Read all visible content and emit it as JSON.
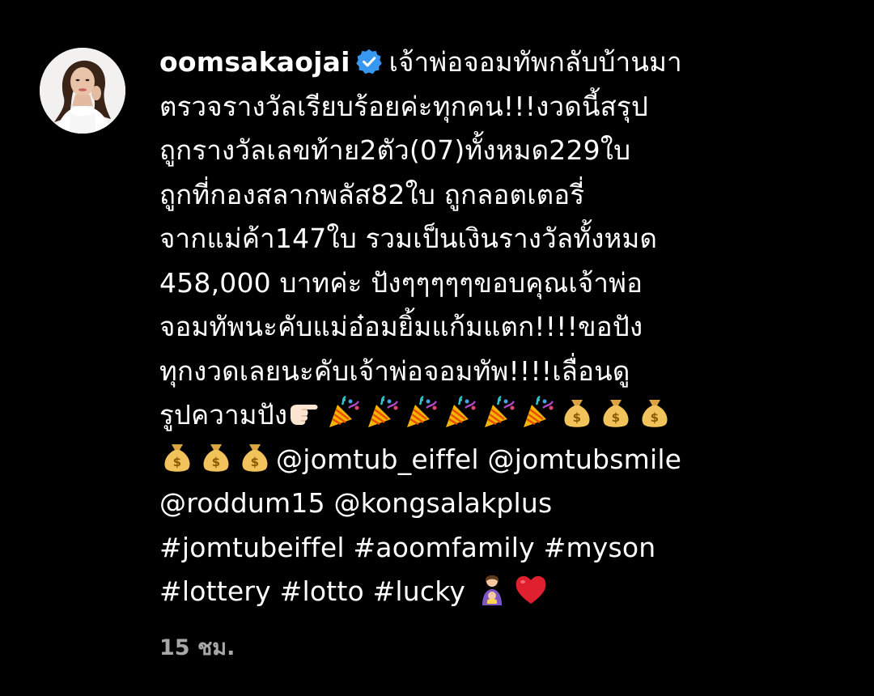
{
  "post": {
    "username": "oomsakaojai",
    "verified_icon": "verified-badge-icon",
    "verified_color": "#3897f0",
    "text_lines": [
      "เจ้าพ่อจอมทัพกลับบ้านมา",
      "ตรวจรางวัลเรียบร้อยค่ะทุกคน!!!งวดนี้สรุป",
      "ถูกรางวัลเลขท้าย2ตัว(07)ทั้งหมด229ใบ",
      "ถูกที่กองสลากพลัส82ใบ ถูกลอตเตอรี่",
      "จากแม่ค้า147ใบ รวมเป็นเงินรางวัลทั้งหมด",
      "458,000 บาทค่ะ ปังๆๆๆๆๆขอบคุณเจ้าพ่อ",
      "จอมทัพนะคับแม่อ๋อมยิ้มแก้มแตก!!!!ขอปัง",
      "ทุกงวดเลยนะคับเจ้าพ่อจอมทัพ!!!!เลื่อนดู",
      "รูปความปัง"
    ],
    "emoji_icons": {
      "pointing": "backhand-index-pointing-right-icon",
      "party": "party-popper-icon",
      "money": "money-bag-icon",
      "person": "woman-with-baby-icon",
      "heart": "red-heart-icon"
    },
    "mentions": [
      "@jomtub_eiffel",
      "@jomtubsmile",
      "@roddum15",
      "@kongsalakplus"
    ],
    "hashtags": [
      "#jomtubeiffel",
      "#aoomfamily",
      "#myson",
      "#lottery",
      "#lotto",
      "#lucky"
    ],
    "timestamp": "15 ชม."
  },
  "colors": {
    "background": "#000000",
    "text": "#ffffff",
    "timestamp": "#a8a8a8"
  }
}
